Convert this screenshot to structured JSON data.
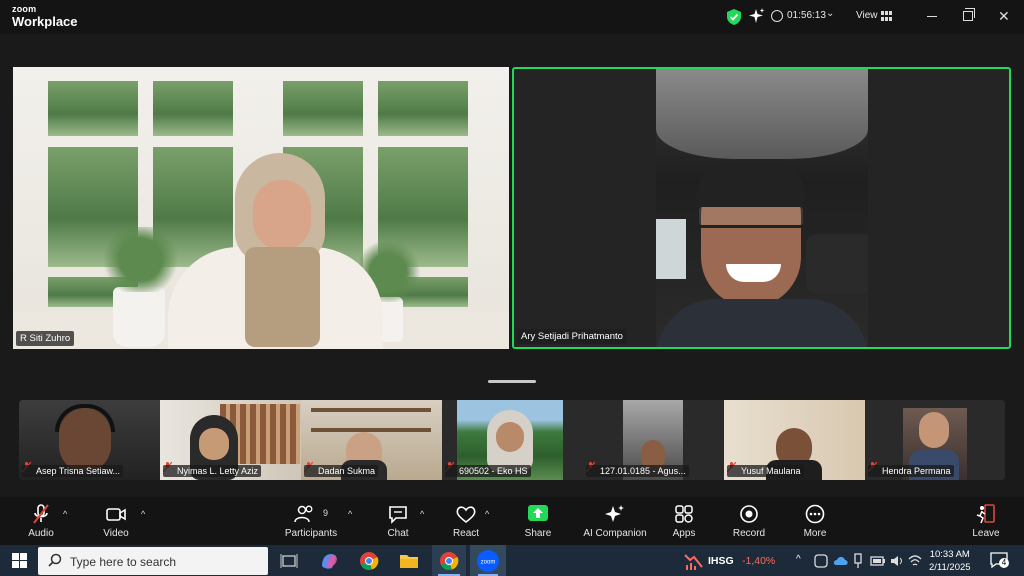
{
  "titlebar": {
    "logo_line1": "zoom",
    "logo_line2": "Workplace",
    "timer": "01:56:13",
    "view_label": "View"
  },
  "main_tiles": [
    {
      "name": "R Siti Zuhro"
    },
    {
      "name": "Ary Setijadi Prihatmanto"
    }
  ],
  "gallery": [
    {
      "name": "Asep Trisna Setiaw..."
    },
    {
      "name": "Nyimas L. Letty Aziz"
    },
    {
      "name": "Dadan Sukma"
    },
    {
      "name": "690502 - Eko HS"
    },
    {
      "name": "127.01.0185 - Agus..."
    },
    {
      "name": "Yusuf Maulana"
    },
    {
      "name": "Hendra Permana"
    }
  ],
  "toolbar": {
    "audio": "Audio",
    "video": "Video",
    "participants": "Participants",
    "participants_count": "9",
    "chat": "Chat",
    "react": "React",
    "share": "Share",
    "ai_companion": "AI Companion",
    "apps": "Apps",
    "record": "Record",
    "more": "More",
    "leave": "Leave"
  },
  "taskbar": {
    "search_placeholder": "Type here to search",
    "ihsg_label": "IHSG",
    "ihsg_value": "-1,40%",
    "time": "10:33 AM",
    "date": "2/11/2025",
    "notification_count": "4"
  },
  "colors": {
    "active_speaker": "#23d959",
    "share_green": "#23d959",
    "muted_red": "#e0453a",
    "leave_red": "#e0453a"
  }
}
